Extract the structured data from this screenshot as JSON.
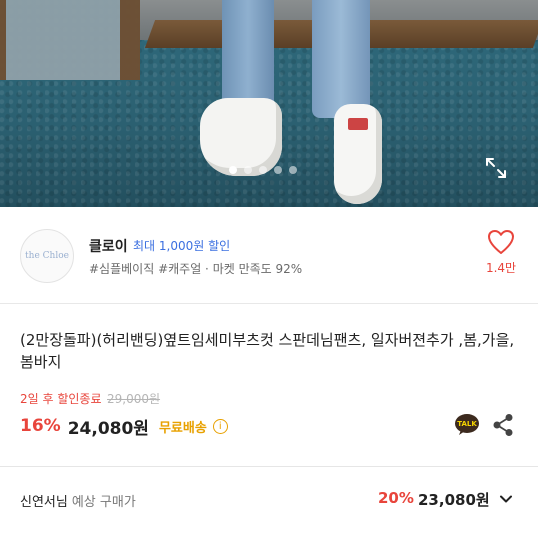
{
  "gallery": {
    "dot_count": 5,
    "active_index": 0,
    "expand_icon": "expand-icon"
  },
  "seller": {
    "avatar_text": "the Chloe",
    "name": "클로이",
    "discount": "최대 1,000원 할인",
    "tags": "#심플베이직 #캐주얼 · 마켓 만족도 92%",
    "like_count": "1.4만",
    "heart_icon": "heart-icon"
  },
  "product": {
    "title": "(2만장돌파)(허리밴딩)옆트임세미부츠컷 스판데님팬츠, 일자버젼추가 ,봄,가을,봄바지",
    "deadline": "2일 후 할인종료",
    "original_price": "29,000원",
    "discount": "16%",
    "sale_price": "24,080원",
    "shipping": "무료배송",
    "info_icon_glyph": "i"
  },
  "member_price": {
    "name": "신연서님",
    "label": "예상 구매가",
    "discount": "20%",
    "price": "23,080원"
  },
  "colors": {
    "accent_red": "#e8453c",
    "link_blue": "#3b6fe0",
    "shipping_yellow": "#e8a100"
  }
}
